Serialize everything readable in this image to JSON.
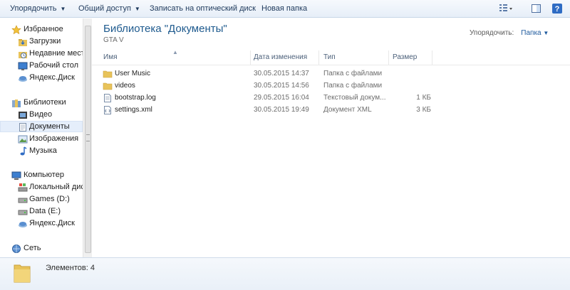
{
  "toolbar": {
    "organize": "Упорядочить",
    "share": "Общий доступ",
    "burn": "Записать на оптический диск",
    "new_folder": "Новая папка",
    "icons": [
      "view-options-icon",
      "preview-pane-icon",
      "help-icon"
    ]
  },
  "sidebar": {
    "favorites": {
      "title": "Избранное",
      "items": [
        "Загрузки",
        "Недавние места",
        "Рабочий стол",
        "Яндекс.Диск"
      ]
    },
    "libraries": {
      "title": "Библиотеки",
      "items": [
        "Видео",
        "Документы",
        "Изображения",
        "Музыка"
      ],
      "selected": "Документы"
    },
    "computer": {
      "title": "Компьютер",
      "items": [
        "Локальный диск",
        "Games (D:)",
        "Data (E:)",
        "Яндекс.Диск"
      ]
    },
    "network": {
      "title": "Сеть"
    }
  },
  "main": {
    "library_title": "Библиотека \"Документы\"",
    "library_subtitle": "GTA V",
    "arrange_label": "Упорядочить:",
    "arrange_value": "Папка",
    "columns": [
      "Имя",
      "Дата изменения",
      "Тип",
      "Размер"
    ],
    "files": [
      {
        "name": "User Music",
        "date": "30.05.2015 14:37",
        "type": "Папка с файлами",
        "size": "",
        "icon": "folder-icon"
      },
      {
        "name": "videos",
        "date": "30.05.2015 14:56",
        "type": "Папка с файлами",
        "size": "",
        "icon": "folder-icon"
      },
      {
        "name": "bootstrap.log",
        "date": "29.05.2015 16:04",
        "type": "Текстовый докум...",
        "size": "1 КБ",
        "icon": "text-file-icon"
      },
      {
        "name": "settings.xml",
        "date": "30.05.2015 19:49",
        "type": "Документ XML",
        "size": "3 КБ",
        "icon": "xml-file-icon"
      }
    ]
  },
  "status": {
    "count_text": "Элементов: 4"
  },
  "colors": {
    "accent": "#1e5a8e",
    "folder": "#e8c35a",
    "selection": "#e5eefb"
  }
}
